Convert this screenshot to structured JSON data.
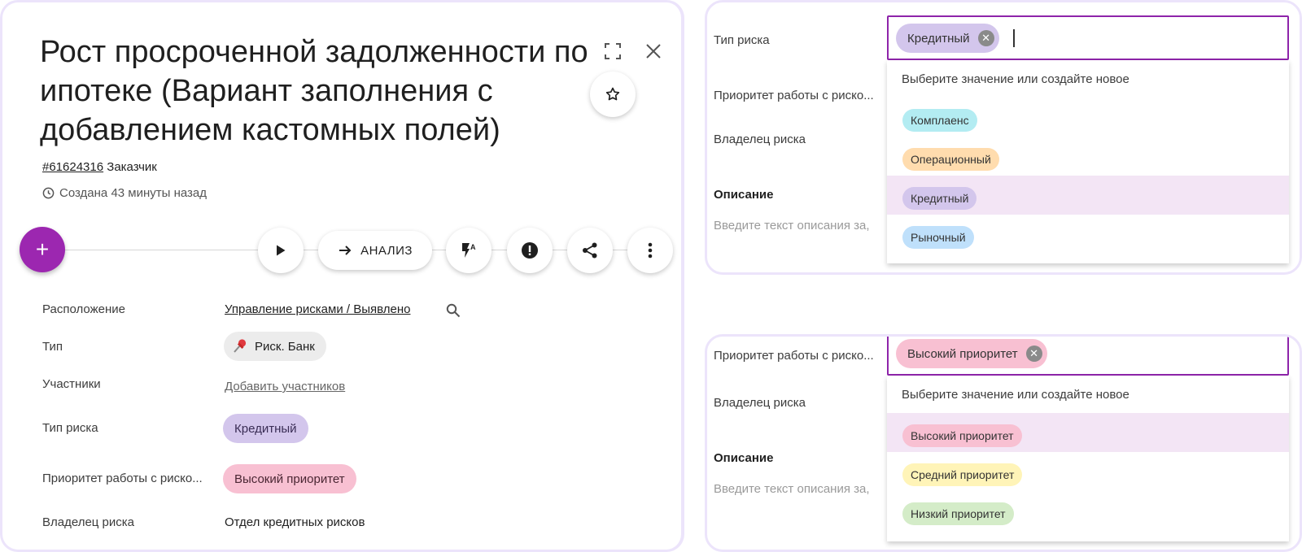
{
  "left": {
    "title": "Рост просроченной задолженности по ипотеке (Вариант заполнения с добавлением кастомных полей)",
    "id": "#61624316",
    "customer": "Заказчик",
    "created": "Создана 43 минуты назад",
    "fab_label": "+",
    "analysis_label": "АНАЛИЗ",
    "fields": {
      "location_label": "Расположение",
      "location_value": "Управление рисками / Выявлено",
      "type_label": "Тип",
      "type_value": "Риск. Банк",
      "participants_label": "Участники",
      "participants_value": "Добавить участников",
      "risk_type_label": "Тип риска",
      "risk_type_value": "Кредитный",
      "priority_label": "Приоритет работы с риско...",
      "priority_value": "Высокий приоритет",
      "owner_label": "Владелец риска",
      "owner_value": "Отдел кредитных рисков"
    }
  },
  "top_right": {
    "risk_type_label": "Тип риска",
    "priority_label": "Приоритет работы с риско...",
    "owner_label": "Владелец риска",
    "description_label": "Описание",
    "description_placeholder": "Введите текст описания за,",
    "selected": "Кредитный",
    "hint": "Выберите значение или создайте новое",
    "options": [
      "Комплаенс",
      "Операционный",
      "Кредитный",
      "Рыночный"
    ]
  },
  "bottom_right": {
    "priority_label": "Приоритет работы с риско...",
    "owner_label": "Владелец риска",
    "description_label": "Описание",
    "description_placeholder": "Введите текст описания за,",
    "selected": "Высокий приоритет",
    "hint": "Выберите значение или создайте новое",
    "options": [
      "Высокий приоритет",
      "Средний приоритет",
      "Низкий приоритет"
    ]
  },
  "colors": {
    "accent": "#9c27b0",
    "border_focus": "#8e24aa",
    "chip_kreditny": "#d3c6ec",
    "chip_vysokiy": "#f8c0d2",
    "chip_komplaens": "#b3ecf2",
    "chip_operacionny": "#ffdcae",
    "chip_rynochny": "#bfe0fb",
    "chip_sredniy": "#fff4b8",
    "chip_nizkiy": "#d4ecc8",
    "chip_risk_bank": "#ececec"
  },
  "icons": [
    "expand-icon",
    "close-icon",
    "star-icon",
    "clock-icon",
    "play-icon",
    "arrow-right-icon",
    "flash-auto-icon",
    "alert-icon",
    "share-icon",
    "more-vert-icon",
    "search-icon",
    "pushpin-icon",
    "clear-icon"
  ]
}
